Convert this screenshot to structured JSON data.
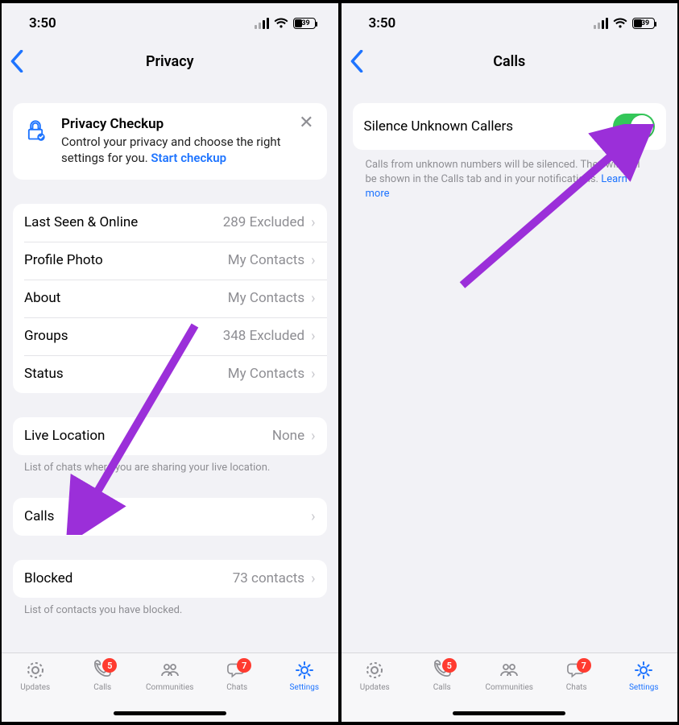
{
  "status": {
    "time": "3:50",
    "battery": "39"
  },
  "left": {
    "title": "Privacy",
    "checkup": {
      "title": "Privacy Checkup",
      "desc": "Control your privacy and choose the right settings for you.",
      "link": "Start checkup"
    },
    "group1": [
      {
        "label": "Last Seen & Online",
        "value": "289 Excluded"
      },
      {
        "label": "Profile Photo",
        "value": "My Contacts"
      },
      {
        "label": "About",
        "value": "My Contacts"
      },
      {
        "label": "Groups",
        "value": "348 Excluded"
      },
      {
        "label": "Status",
        "value": "My Contacts"
      }
    ],
    "liveloc": {
      "label": "Live Location",
      "value": "None"
    },
    "liveloc_note": "List of chats where you are sharing your live location.",
    "calls": {
      "label": "Calls",
      "value": ""
    },
    "blocked": {
      "label": "Blocked",
      "value": "73 contacts"
    },
    "blocked_note": "List of contacts you have blocked."
  },
  "right": {
    "title": "Calls",
    "silence": {
      "label": "Silence Unknown Callers"
    },
    "desc1": "Calls from unknown numbers will be silenced. They will still be shown in the Calls tab and in your notifications.",
    "learn": "Learn more"
  },
  "tabs": {
    "updates": "Updates",
    "calls": "Calls",
    "communities": "Communities",
    "chats": "Chats",
    "settings": "Settings",
    "calls_badge": "5",
    "chats_badge": "7"
  }
}
